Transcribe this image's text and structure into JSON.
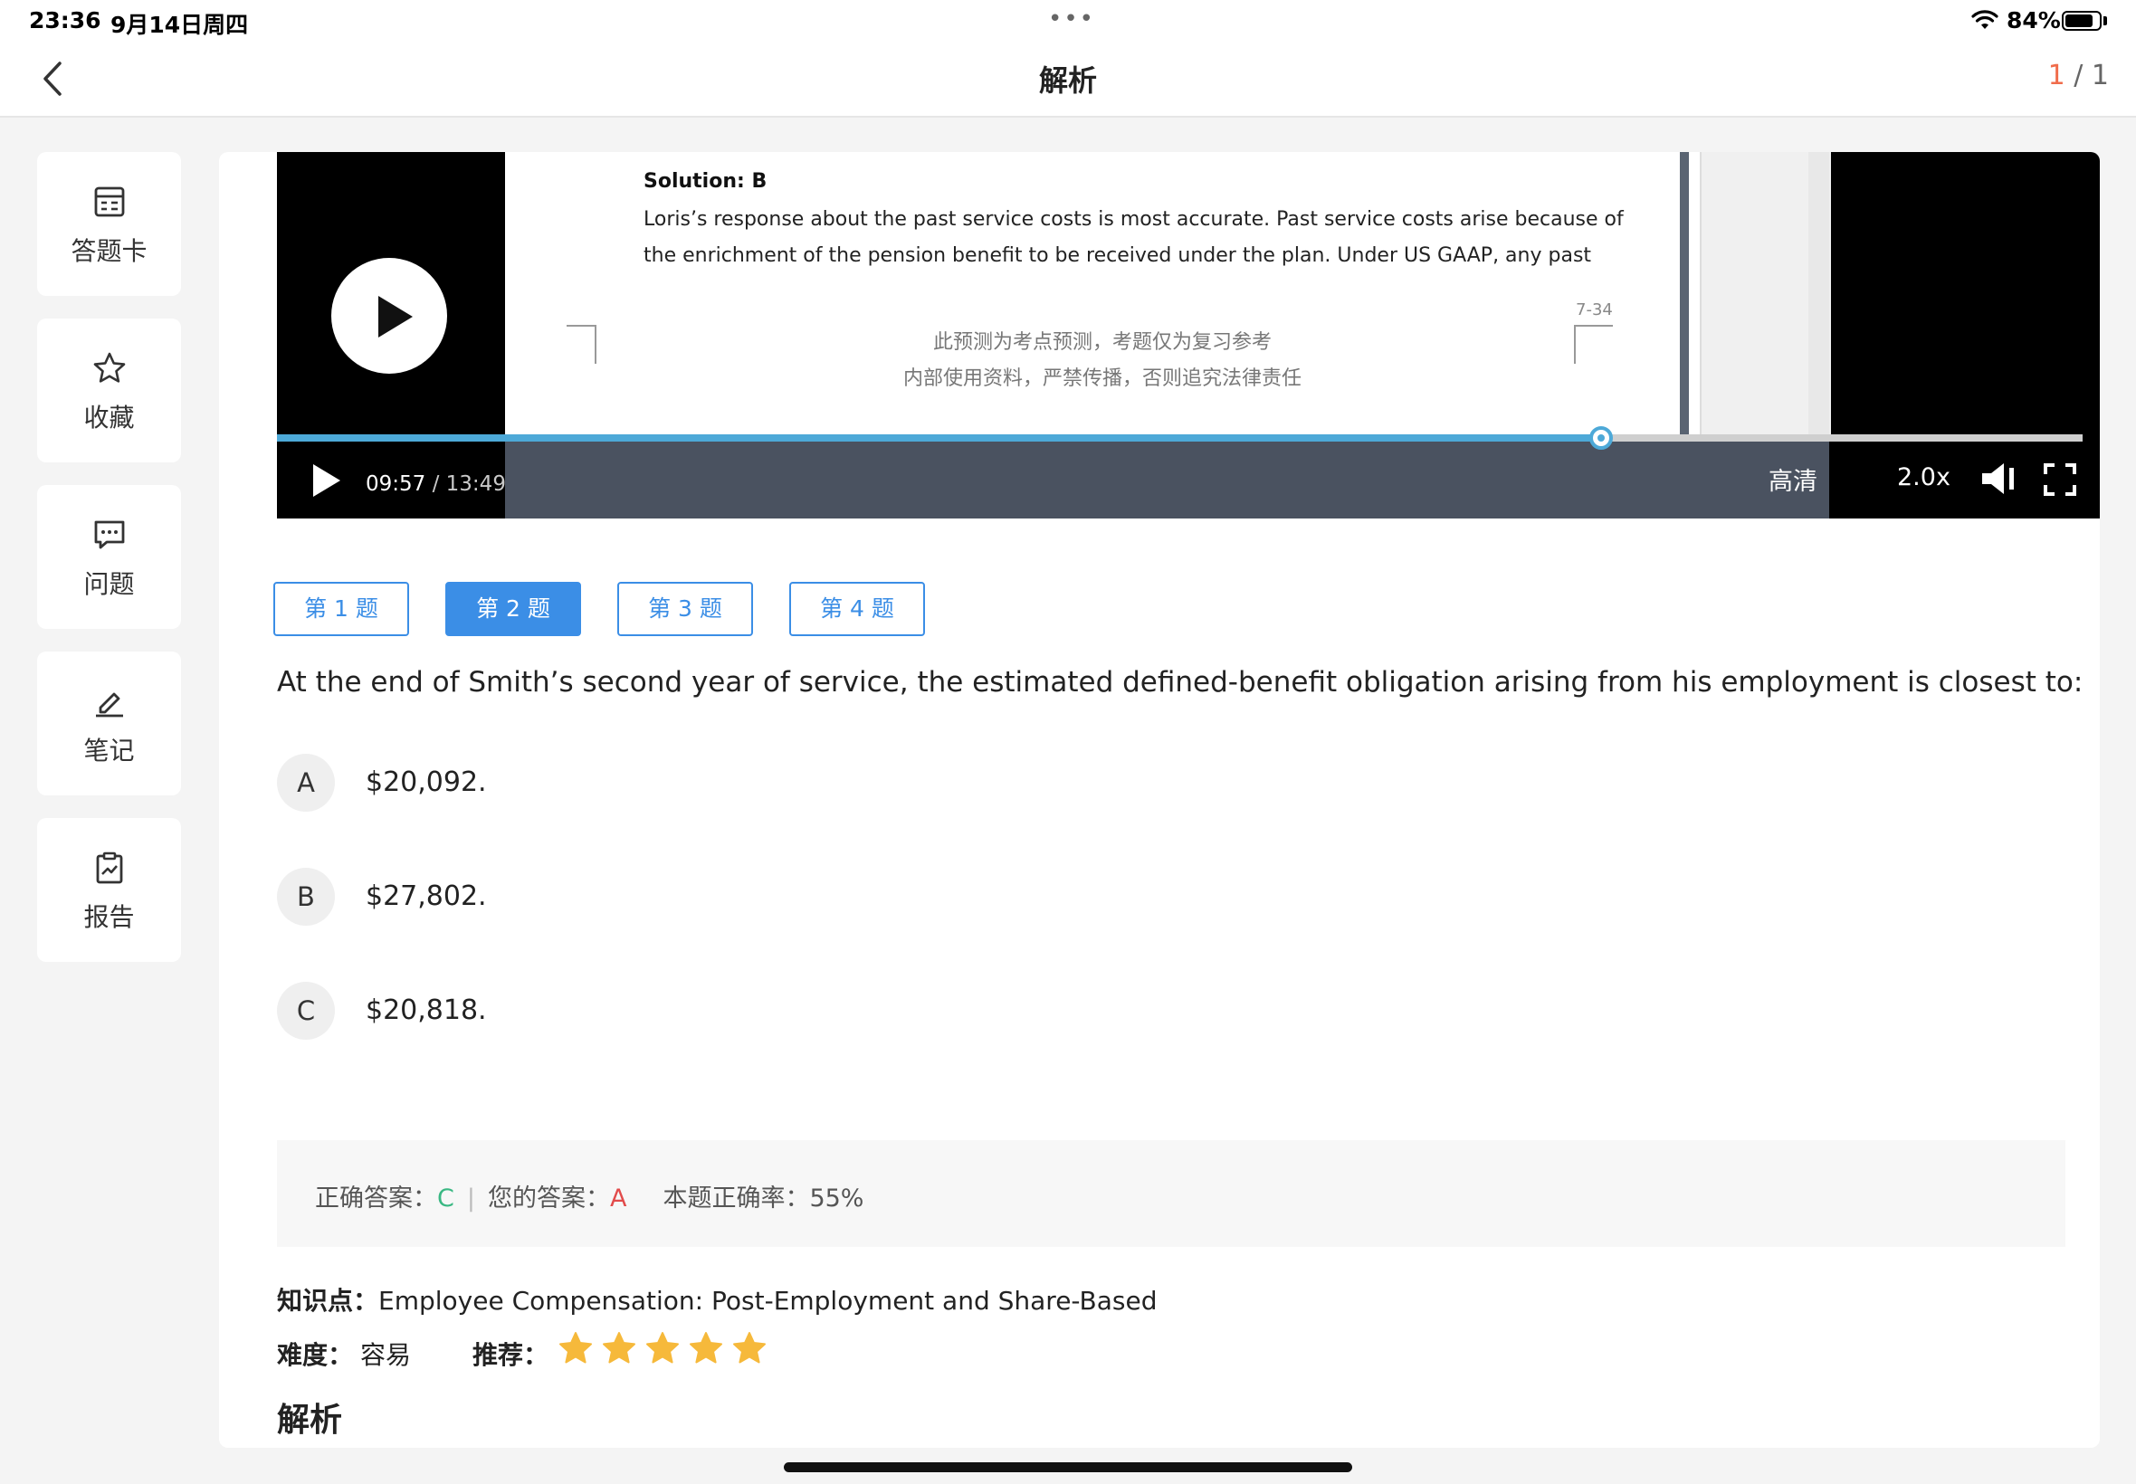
{
  "status_bar": {
    "time": "23:36",
    "date": "9月14日周四",
    "battery": "84%",
    "battery_level": 0.84
  },
  "nav": {
    "title": "解析",
    "page_current": "1",
    "page_total": "/ 1"
  },
  "sidebar": {
    "items": [
      {
        "label": "答题卡",
        "icon": "answer-sheet-icon"
      },
      {
        "label": "收藏",
        "icon": "star-icon"
      },
      {
        "label": "问题",
        "icon": "chat-icon"
      },
      {
        "label": "笔记",
        "icon": "pen-icon"
      },
      {
        "label": "报告",
        "icon": "report-icon"
      }
    ]
  },
  "video": {
    "slide_solution": "Solution: B",
    "slide_line1": "Loris’s response about the past service costs is most accurate. Past service costs arise because of",
    "slide_line2": "the enrichment of the pension benefit to be received under the plan. Under US GAAP, any past",
    "slide_page": "7-34",
    "watermark1": "此预测为考点预测，考题仅为复习参考",
    "watermark2": "内部使用资料，严禁传播，否则追究法律责任",
    "current_time": "09:57",
    "total_time": "/ 13:49",
    "progress": 0.7335,
    "quality": "高清",
    "speed": "2.0x"
  },
  "tabs": [
    {
      "label": "第 1 题"
    },
    {
      "label": "第 2 题"
    },
    {
      "label": "第 3 题"
    },
    {
      "label": "第 4 题"
    }
  ],
  "active_tab": 1,
  "question": "At the end of Smith’s second year of service, the estimated defined-benefit obligation arising from his employment is closest to:",
  "options": [
    {
      "letter": "A",
      "value": "$20,092."
    },
    {
      "letter": "B",
      "value": "$27,802."
    },
    {
      "letter": "C",
      "value": "$20,818."
    }
  ],
  "result": {
    "correct_label": "正确答案：",
    "correct_value": "C",
    "sep": "|",
    "your_label": "您的答案：",
    "your_value": "A",
    "rate_label": "本题正确率：",
    "rate_value": "55%"
  },
  "knowledge": {
    "label": "知识点：",
    "value": "Employee Compensation: Post-Employment and Share-Based"
  },
  "difficulty": {
    "label": "难度：",
    "value": "容易",
    "recommend_label": "推荐：",
    "stars": 5
  },
  "analysis_title": "解析",
  "colors": {
    "accent": "#3b8ee6",
    "correct": "#3ab883",
    "wrong": "#e24b4b",
    "progress": "#4da9d8",
    "star": "#f6b93b"
  }
}
